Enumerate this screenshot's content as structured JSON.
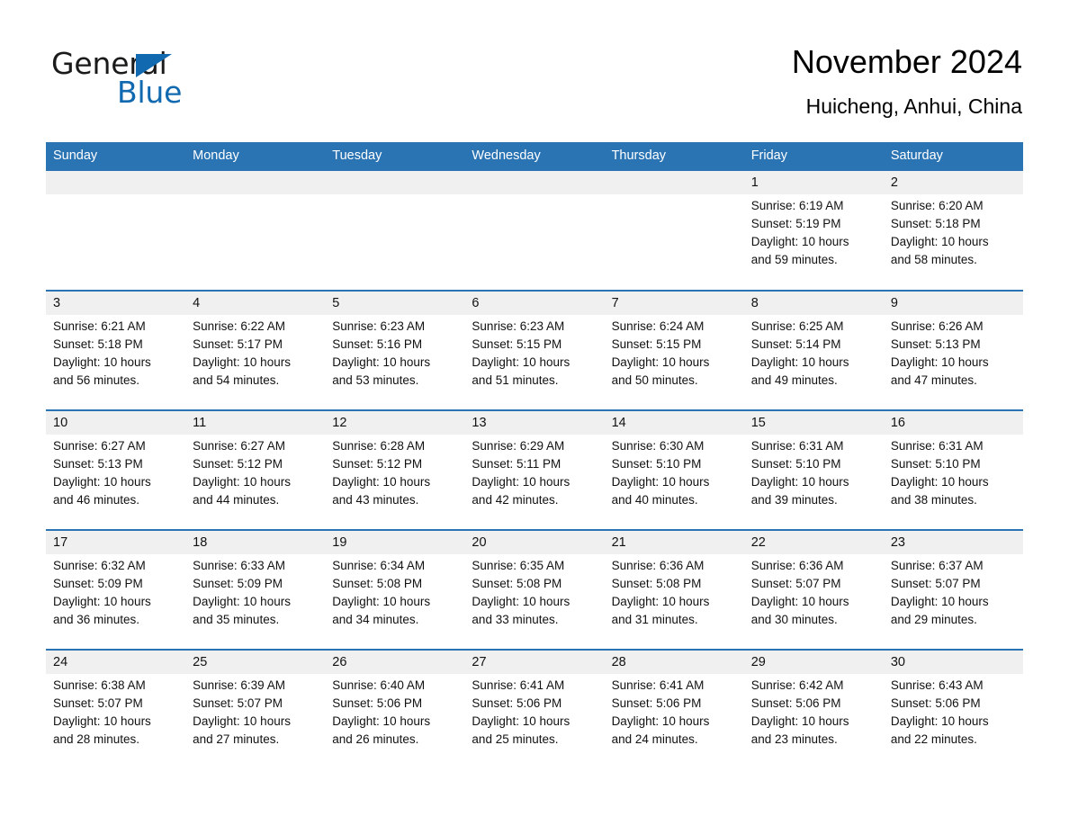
{
  "logo": {
    "word1": "General",
    "word2": "Blue",
    "triangle_icon": "triangle-icon",
    "brand_color": "#1169b0"
  },
  "header": {
    "title": "November 2024",
    "subtitle": "Huicheng, Anhui, China"
  },
  "theme": {
    "header_blue": "#2b74b4",
    "band_gray": "#f0f0f0",
    "text": "#111111"
  },
  "weekdays": [
    "Sunday",
    "Monday",
    "Tuesday",
    "Wednesday",
    "Thursday",
    "Friday",
    "Saturday"
  ],
  "weeks": [
    [
      {
        "day": "",
        "empty": true
      },
      {
        "day": "",
        "empty": true
      },
      {
        "day": "",
        "empty": true
      },
      {
        "day": "",
        "empty": true
      },
      {
        "day": "",
        "empty": true
      },
      {
        "day": "1",
        "sunrise": "Sunrise: 6:19 AM",
        "sunset": "Sunset: 5:19 PM",
        "daylight1": "Daylight: 10 hours",
        "daylight2": "and 59 minutes."
      },
      {
        "day": "2",
        "sunrise": "Sunrise: 6:20 AM",
        "sunset": "Sunset: 5:18 PM",
        "daylight1": "Daylight: 10 hours",
        "daylight2": "and 58 minutes."
      }
    ],
    [
      {
        "day": "3",
        "sunrise": "Sunrise: 6:21 AM",
        "sunset": "Sunset: 5:18 PM",
        "daylight1": "Daylight: 10 hours",
        "daylight2": "and 56 minutes."
      },
      {
        "day": "4",
        "sunrise": "Sunrise: 6:22 AM",
        "sunset": "Sunset: 5:17 PM",
        "daylight1": "Daylight: 10 hours",
        "daylight2": "and 54 minutes."
      },
      {
        "day": "5",
        "sunrise": "Sunrise: 6:23 AM",
        "sunset": "Sunset: 5:16 PM",
        "daylight1": "Daylight: 10 hours",
        "daylight2": "and 53 minutes."
      },
      {
        "day": "6",
        "sunrise": "Sunrise: 6:23 AM",
        "sunset": "Sunset: 5:15 PM",
        "daylight1": "Daylight: 10 hours",
        "daylight2": "and 51 minutes."
      },
      {
        "day": "7",
        "sunrise": "Sunrise: 6:24 AM",
        "sunset": "Sunset: 5:15 PM",
        "daylight1": "Daylight: 10 hours",
        "daylight2": "and 50 minutes."
      },
      {
        "day": "8",
        "sunrise": "Sunrise: 6:25 AM",
        "sunset": "Sunset: 5:14 PM",
        "daylight1": "Daylight: 10 hours",
        "daylight2": "and 49 minutes."
      },
      {
        "day": "9",
        "sunrise": "Sunrise: 6:26 AM",
        "sunset": "Sunset: 5:13 PM",
        "daylight1": "Daylight: 10 hours",
        "daylight2": "and 47 minutes."
      }
    ],
    [
      {
        "day": "10",
        "sunrise": "Sunrise: 6:27 AM",
        "sunset": "Sunset: 5:13 PM",
        "daylight1": "Daylight: 10 hours",
        "daylight2": "and 46 minutes."
      },
      {
        "day": "11",
        "sunrise": "Sunrise: 6:27 AM",
        "sunset": "Sunset: 5:12 PM",
        "daylight1": "Daylight: 10 hours",
        "daylight2": "and 44 minutes."
      },
      {
        "day": "12",
        "sunrise": "Sunrise: 6:28 AM",
        "sunset": "Sunset: 5:12 PM",
        "daylight1": "Daylight: 10 hours",
        "daylight2": "and 43 minutes."
      },
      {
        "day": "13",
        "sunrise": "Sunrise: 6:29 AM",
        "sunset": "Sunset: 5:11 PM",
        "daylight1": "Daylight: 10 hours",
        "daylight2": "and 42 minutes."
      },
      {
        "day": "14",
        "sunrise": "Sunrise: 6:30 AM",
        "sunset": "Sunset: 5:10 PM",
        "daylight1": "Daylight: 10 hours",
        "daylight2": "and 40 minutes."
      },
      {
        "day": "15",
        "sunrise": "Sunrise: 6:31 AM",
        "sunset": "Sunset: 5:10 PM",
        "daylight1": "Daylight: 10 hours",
        "daylight2": "and 39 minutes."
      },
      {
        "day": "16",
        "sunrise": "Sunrise: 6:31 AM",
        "sunset": "Sunset: 5:10 PM",
        "daylight1": "Daylight: 10 hours",
        "daylight2": "and 38 minutes."
      }
    ],
    [
      {
        "day": "17",
        "sunrise": "Sunrise: 6:32 AM",
        "sunset": "Sunset: 5:09 PM",
        "daylight1": "Daylight: 10 hours",
        "daylight2": "and 36 minutes."
      },
      {
        "day": "18",
        "sunrise": "Sunrise: 6:33 AM",
        "sunset": "Sunset: 5:09 PM",
        "daylight1": "Daylight: 10 hours",
        "daylight2": "and 35 minutes."
      },
      {
        "day": "19",
        "sunrise": "Sunrise: 6:34 AM",
        "sunset": "Sunset: 5:08 PM",
        "daylight1": "Daylight: 10 hours",
        "daylight2": "and 34 minutes."
      },
      {
        "day": "20",
        "sunrise": "Sunrise: 6:35 AM",
        "sunset": "Sunset: 5:08 PM",
        "daylight1": "Daylight: 10 hours",
        "daylight2": "and 33 minutes."
      },
      {
        "day": "21",
        "sunrise": "Sunrise: 6:36 AM",
        "sunset": "Sunset: 5:08 PM",
        "daylight1": "Daylight: 10 hours",
        "daylight2": "and 31 minutes."
      },
      {
        "day": "22",
        "sunrise": "Sunrise: 6:36 AM",
        "sunset": "Sunset: 5:07 PM",
        "daylight1": "Daylight: 10 hours",
        "daylight2": "and 30 minutes."
      },
      {
        "day": "23",
        "sunrise": "Sunrise: 6:37 AM",
        "sunset": "Sunset: 5:07 PM",
        "daylight1": "Daylight: 10 hours",
        "daylight2": "and 29 minutes."
      }
    ],
    [
      {
        "day": "24",
        "sunrise": "Sunrise: 6:38 AM",
        "sunset": "Sunset: 5:07 PM",
        "daylight1": "Daylight: 10 hours",
        "daylight2": "and 28 minutes."
      },
      {
        "day": "25",
        "sunrise": "Sunrise: 6:39 AM",
        "sunset": "Sunset: 5:07 PM",
        "daylight1": "Daylight: 10 hours",
        "daylight2": "and 27 minutes."
      },
      {
        "day": "26",
        "sunrise": "Sunrise: 6:40 AM",
        "sunset": "Sunset: 5:06 PM",
        "daylight1": "Daylight: 10 hours",
        "daylight2": "and 26 minutes."
      },
      {
        "day": "27",
        "sunrise": "Sunrise: 6:41 AM",
        "sunset": "Sunset: 5:06 PM",
        "daylight1": "Daylight: 10 hours",
        "daylight2": "and 25 minutes."
      },
      {
        "day": "28",
        "sunrise": "Sunrise: 6:41 AM",
        "sunset": "Sunset: 5:06 PM",
        "daylight1": "Daylight: 10 hours",
        "daylight2": "and 24 minutes."
      },
      {
        "day": "29",
        "sunrise": "Sunrise: 6:42 AM",
        "sunset": "Sunset: 5:06 PM",
        "daylight1": "Daylight: 10 hours",
        "daylight2": "and 23 minutes."
      },
      {
        "day": "30",
        "sunrise": "Sunrise: 6:43 AM",
        "sunset": "Sunset: 5:06 PM",
        "daylight1": "Daylight: 10 hours",
        "daylight2": "and 22 minutes."
      }
    ]
  ]
}
